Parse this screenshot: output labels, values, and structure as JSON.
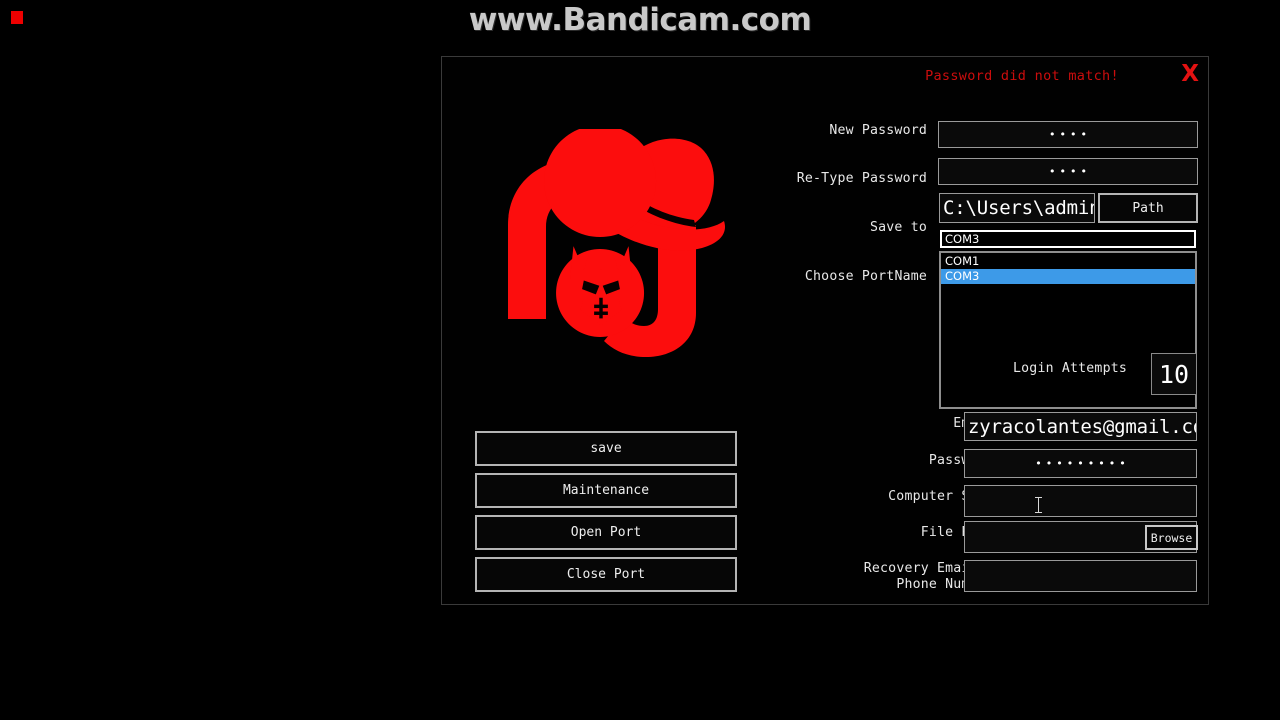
{
  "recorder": {
    "watermark": "www.Bandicam.com",
    "rec_indicator": "rec-dot"
  },
  "window": {
    "close_label": "X",
    "error_message": "Password did not match!"
  },
  "logo": {
    "name": "skull-fedora-logo",
    "color": "#fc0d0d"
  },
  "form": {
    "new_password": {
      "label": "New Password",
      "value": "••••",
      "masked": true
    },
    "retype_password": {
      "label": "Re-Type Password",
      "value": "••••",
      "masked": true
    },
    "save_to": {
      "label": "Save to",
      "value": "C:\\Users\\admin\\",
      "button_label": "Path"
    },
    "port_name": {
      "label": "Choose PortName",
      "selected": "COM3",
      "options": [
        "COM1",
        "COM3"
      ]
    },
    "login_attempts": {
      "label": "Login Attempts",
      "value": "10"
    },
    "email": {
      "label": "Email",
      "value": "zyracolantes@gmail.com"
    },
    "password": {
      "label": "Password",
      "value": "•••••••••",
      "masked": true
    },
    "computer_shop": {
      "label": "Computer Shop",
      "value": ""
    },
    "file_path": {
      "label": "File Path",
      "value": "",
      "button_label": "Browse"
    },
    "recovery_contact": {
      "label": "Recovery Email /\nPhone Number",
      "value": ""
    }
  },
  "actions": {
    "save": "save",
    "maintenance": "Maintenance",
    "open_port": "Open Port",
    "close_port": "Close Port"
  },
  "colors": {
    "accent_red": "#fc0d0d",
    "error_red": "#cc0d0d",
    "highlight_blue": "#3d9ae8",
    "background": "#000000",
    "border_gray": "#9a9a9a"
  }
}
